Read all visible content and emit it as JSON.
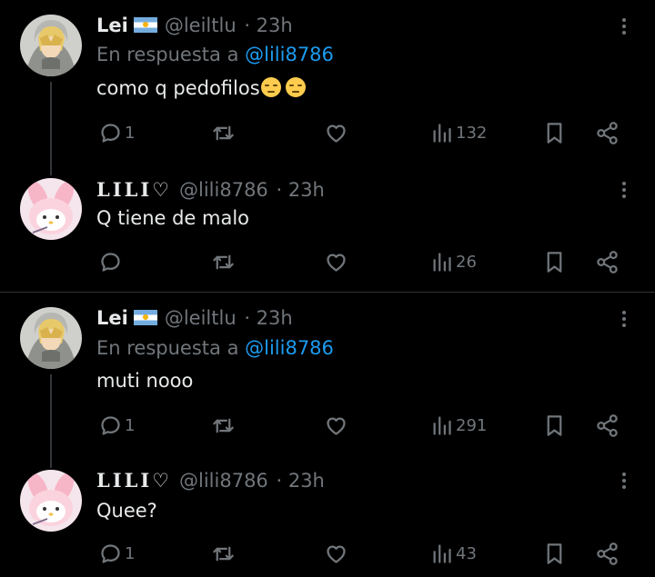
{
  "tweets": [
    {
      "name": "Lei",
      "handle": "@leiltlu",
      "time": "· 23h",
      "reply_prefix": "En respuesta a",
      "reply_to": "@lili8786",
      "text": "como q pedofilos",
      "emojis": [
        "pensive-face",
        "pensive-face"
      ],
      "replies": "1",
      "views": "132"
    },
    {
      "name": "LILI♡",
      "handle": "@lili8786",
      "time": "· 23h",
      "text": "Q tiene de malo",
      "replies": "",
      "views": "26"
    },
    {
      "name": "Lei",
      "handle": "@leiltlu",
      "time": "· 23h",
      "reply_prefix": "En respuesta a",
      "reply_to": "@lili8786",
      "text": "muti nooo",
      "replies": "1",
      "views": "291"
    },
    {
      "name": "LILI♡",
      "handle": "@lili8786",
      "time": "· 23h",
      "text": "Quee?",
      "replies": "1",
      "views": "43"
    }
  ],
  "colors": {
    "background": "#000000",
    "text": "#e7e9ea",
    "muted": "#71767b",
    "link": "#1d9bf0"
  }
}
